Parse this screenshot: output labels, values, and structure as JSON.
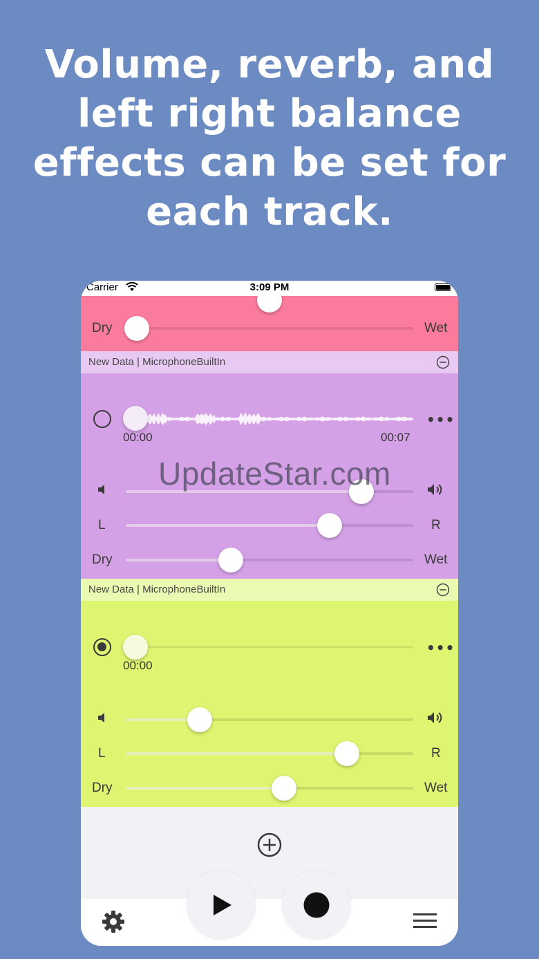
{
  "headline": "Volume, reverb, and left right balance effects can be set for each track.",
  "status": {
    "carrier": "Carrier",
    "time": "3:09 PM"
  },
  "top_track": {
    "color": "#fb7b9d",
    "labels": {
      "dry": "Dry",
      "wet": "Wet"
    },
    "reverb": 0.04
  },
  "tracks": [
    {
      "header": "New Data | MicrophoneBuiltIn",
      "color": "#d4a0e6",
      "header_color": "#e8c9f2",
      "selected": false,
      "position": 0.0,
      "time_start": "00:00",
      "time_end": "00:07",
      "volume": 0.82,
      "balance": 0.71,
      "reverb": 0.37,
      "labels": {
        "left": "L",
        "right": "R",
        "dry": "Dry",
        "wet": "Wet"
      }
    },
    {
      "header": "New Data | MicrophoneBuiltIn",
      "color": "#ddf571",
      "header_color": "#eafab2",
      "selected": true,
      "position": 0.0,
      "time_start": "00:00",
      "volume": 0.26,
      "balance": 0.77,
      "reverb": 0.55,
      "labels": {
        "left": "L",
        "right": "R",
        "dry": "Dry",
        "wet": "Wet"
      }
    }
  ],
  "watermark": "UpdateStar.com",
  "icons": [
    "wifi-icon",
    "battery-icon",
    "minus-circle-icon",
    "more-icon",
    "speaker-low-icon",
    "speaker-high-icon",
    "add-circle-icon",
    "play-icon",
    "record-icon",
    "gear-icon",
    "menu-icon"
  ]
}
